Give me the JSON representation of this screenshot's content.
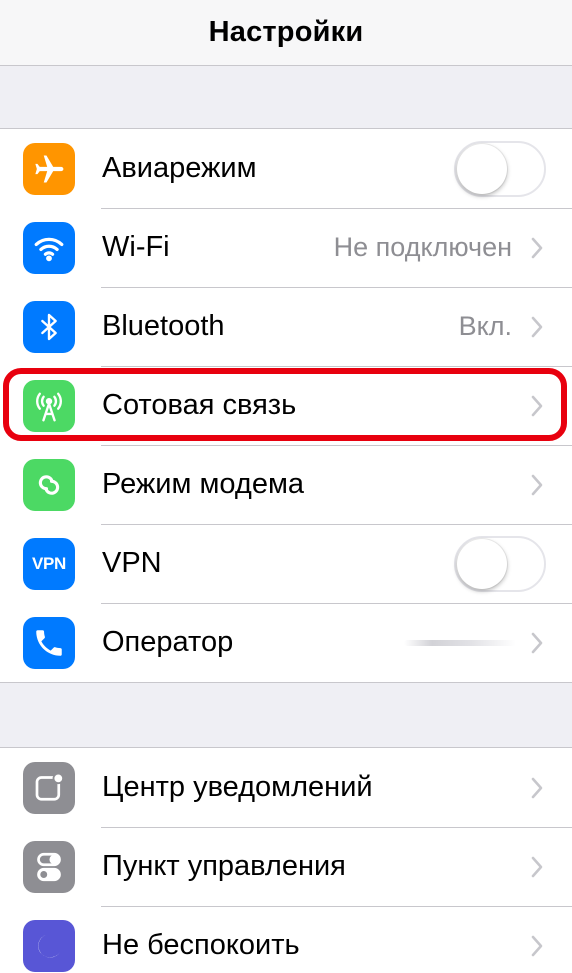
{
  "nav": {
    "title": "Настройки"
  },
  "group1": [
    {
      "label": "Авиарежим",
      "icon": "airplane-icon",
      "color": "#ff9500",
      "accessory": "toggle",
      "on": false
    },
    {
      "label": "Wi-Fi",
      "icon": "wifi-icon",
      "color": "#007aff",
      "value": "Не подключен"
    },
    {
      "label": "Bluetooth",
      "icon": "bluetooth-icon",
      "color": "#007aff",
      "value": "Вкл."
    },
    {
      "label": "Сотовая связь",
      "icon": "cellular-antenna-icon",
      "color": "#4cd964",
      "highlighted": true
    },
    {
      "label": "Режим модема",
      "icon": "chain-link-icon",
      "color": "#4cd964"
    },
    {
      "label": "VPN",
      "icon": "vpn-icon",
      "icon_text": "VPN",
      "color": "#007aff",
      "accessory": "toggle",
      "on": false
    },
    {
      "label": "Оператор",
      "icon": "phone-handset-icon",
      "color": "#007aff",
      "value_blurred": true
    }
  ],
  "group2": [
    {
      "label": "Центр уведомлений",
      "icon": "notification-center-icon",
      "color": "#8e8e93"
    },
    {
      "label": "Пункт управления",
      "icon": "control-center-icon",
      "color": "#8e8e93"
    },
    {
      "label": "Не беспокоить",
      "icon": "moon-icon",
      "color": "#5856d6"
    }
  ],
  "highlight_color": "#e8000e"
}
